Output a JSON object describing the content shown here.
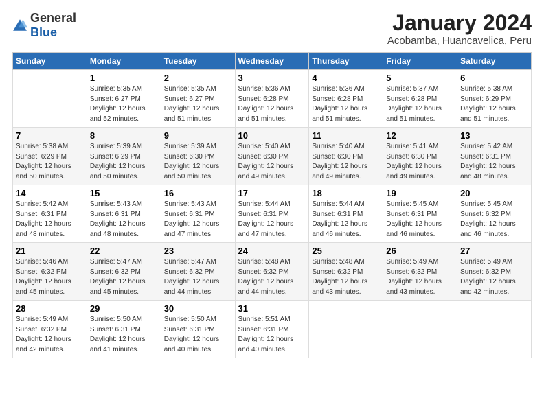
{
  "logo": {
    "general": "General",
    "blue": "Blue"
  },
  "title": "January 2024",
  "subtitle": "Acobamba, Huancavelica, Peru",
  "headers": [
    "Sunday",
    "Monday",
    "Tuesday",
    "Wednesday",
    "Thursday",
    "Friday",
    "Saturday"
  ],
  "weeks": [
    [
      {
        "num": "",
        "info": ""
      },
      {
        "num": "1",
        "info": "Sunrise: 5:35 AM\nSunset: 6:27 PM\nDaylight: 12 hours\nand 52 minutes."
      },
      {
        "num": "2",
        "info": "Sunrise: 5:35 AM\nSunset: 6:27 PM\nDaylight: 12 hours\nand 51 minutes."
      },
      {
        "num": "3",
        "info": "Sunrise: 5:36 AM\nSunset: 6:28 PM\nDaylight: 12 hours\nand 51 minutes."
      },
      {
        "num": "4",
        "info": "Sunrise: 5:36 AM\nSunset: 6:28 PM\nDaylight: 12 hours\nand 51 minutes."
      },
      {
        "num": "5",
        "info": "Sunrise: 5:37 AM\nSunset: 6:28 PM\nDaylight: 12 hours\nand 51 minutes."
      },
      {
        "num": "6",
        "info": "Sunrise: 5:38 AM\nSunset: 6:29 PM\nDaylight: 12 hours\nand 51 minutes."
      }
    ],
    [
      {
        "num": "7",
        "info": "Sunrise: 5:38 AM\nSunset: 6:29 PM\nDaylight: 12 hours\nand 50 minutes."
      },
      {
        "num": "8",
        "info": "Sunrise: 5:39 AM\nSunset: 6:29 PM\nDaylight: 12 hours\nand 50 minutes."
      },
      {
        "num": "9",
        "info": "Sunrise: 5:39 AM\nSunset: 6:30 PM\nDaylight: 12 hours\nand 50 minutes."
      },
      {
        "num": "10",
        "info": "Sunrise: 5:40 AM\nSunset: 6:30 PM\nDaylight: 12 hours\nand 49 minutes."
      },
      {
        "num": "11",
        "info": "Sunrise: 5:40 AM\nSunset: 6:30 PM\nDaylight: 12 hours\nand 49 minutes."
      },
      {
        "num": "12",
        "info": "Sunrise: 5:41 AM\nSunset: 6:30 PM\nDaylight: 12 hours\nand 49 minutes."
      },
      {
        "num": "13",
        "info": "Sunrise: 5:42 AM\nSunset: 6:31 PM\nDaylight: 12 hours\nand 48 minutes."
      }
    ],
    [
      {
        "num": "14",
        "info": "Sunrise: 5:42 AM\nSunset: 6:31 PM\nDaylight: 12 hours\nand 48 minutes."
      },
      {
        "num": "15",
        "info": "Sunrise: 5:43 AM\nSunset: 6:31 PM\nDaylight: 12 hours\nand 48 minutes."
      },
      {
        "num": "16",
        "info": "Sunrise: 5:43 AM\nSunset: 6:31 PM\nDaylight: 12 hours\nand 47 minutes."
      },
      {
        "num": "17",
        "info": "Sunrise: 5:44 AM\nSunset: 6:31 PM\nDaylight: 12 hours\nand 47 minutes."
      },
      {
        "num": "18",
        "info": "Sunrise: 5:44 AM\nSunset: 6:31 PM\nDaylight: 12 hours\nand 46 minutes."
      },
      {
        "num": "19",
        "info": "Sunrise: 5:45 AM\nSunset: 6:31 PM\nDaylight: 12 hours\nand 46 minutes."
      },
      {
        "num": "20",
        "info": "Sunrise: 5:45 AM\nSunset: 6:32 PM\nDaylight: 12 hours\nand 46 minutes."
      }
    ],
    [
      {
        "num": "21",
        "info": "Sunrise: 5:46 AM\nSunset: 6:32 PM\nDaylight: 12 hours\nand 45 minutes."
      },
      {
        "num": "22",
        "info": "Sunrise: 5:47 AM\nSunset: 6:32 PM\nDaylight: 12 hours\nand 45 minutes."
      },
      {
        "num": "23",
        "info": "Sunrise: 5:47 AM\nSunset: 6:32 PM\nDaylight: 12 hours\nand 44 minutes."
      },
      {
        "num": "24",
        "info": "Sunrise: 5:48 AM\nSunset: 6:32 PM\nDaylight: 12 hours\nand 44 minutes."
      },
      {
        "num": "25",
        "info": "Sunrise: 5:48 AM\nSunset: 6:32 PM\nDaylight: 12 hours\nand 43 minutes."
      },
      {
        "num": "26",
        "info": "Sunrise: 5:49 AM\nSunset: 6:32 PM\nDaylight: 12 hours\nand 43 minutes."
      },
      {
        "num": "27",
        "info": "Sunrise: 5:49 AM\nSunset: 6:32 PM\nDaylight: 12 hours\nand 42 minutes."
      }
    ],
    [
      {
        "num": "28",
        "info": "Sunrise: 5:49 AM\nSunset: 6:32 PM\nDaylight: 12 hours\nand 42 minutes."
      },
      {
        "num": "29",
        "info": "Sunrise: 5:50 AM\nSunset: 6:31 PM\nDaylight: 12 hours\nand 41 minutes."
      },
      {
        "num": "30",
        "info": "Sunrise: 5:50 AM\nSunset: 6:31 PM\nDaylight: 12 hours\nand 40 minutes."
      },
      {
        "num": "31",
        "info": "Sunrise: 5:51 AM\nSunset: 6:31 PM\nDaylight: 12 hours\nand 40 minutes."
      },
      {
        "num": "",
        "info": ""
      },
      {
        "num": "",
        "info": ""
      },
      {
        "num": "",
        "info": ""
      }
    ]
  ]
}
